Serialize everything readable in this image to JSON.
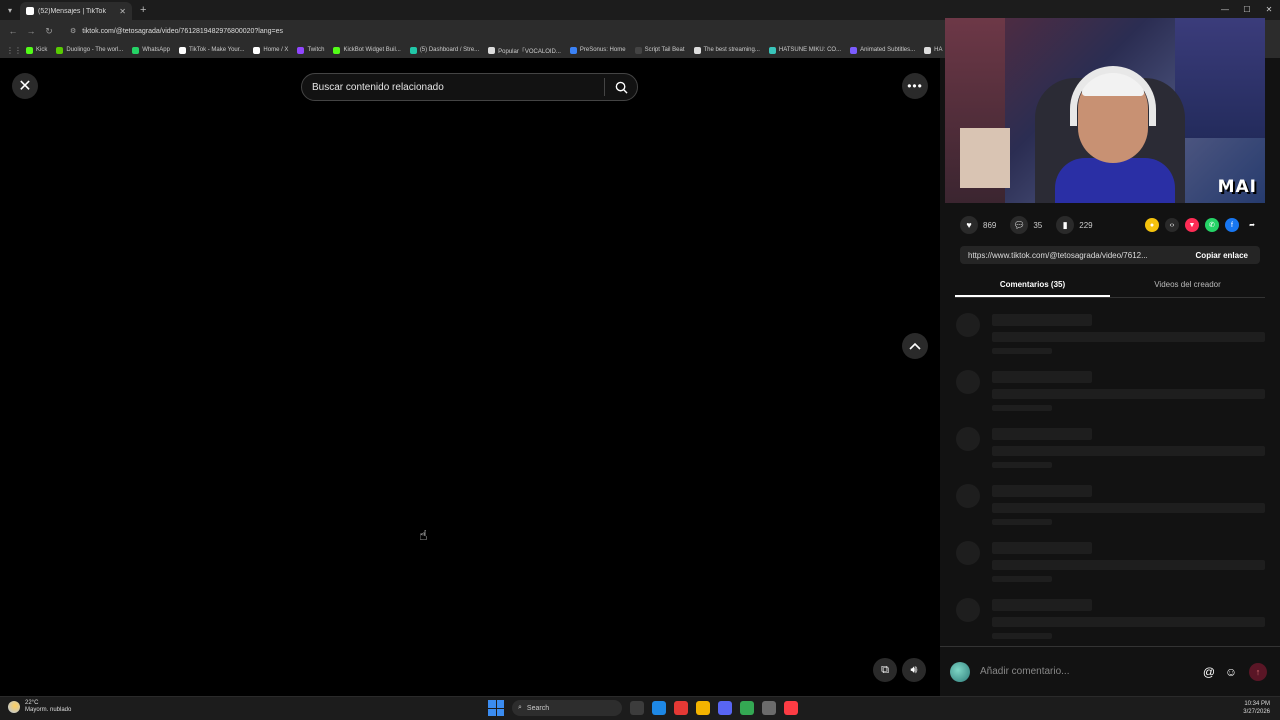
{
  "browser": {
    "tab_title": "(52)Mensajes | TikTok",
    "url": "tiktok.com/@tetosagrada/video/7612819482976800020?lang=es",
    "bookmarks": [
      {
        "label": "Kick",
        "color": "#53fc18"
      },
      {
        "label": "Duolingo - The worl...",
        "color": "#58cc02"
      },
      {
        "label": "WhatsApp",
        "color": "#25d366"
      },
      {
        "label": "TikTok - Make Your...",
        "color": "#ffffff"
      },
      {
        "label": "Home / X",
        "color": "#ffffff"
      },
      {
        "label": "Twitch",
        "color": "#9146ff"
      },
      {
        "label": "KickBot Widget Buil...",
        "color": "#53fc18"
      },
      {
        "label": "(5) Dashboard / Stre...",
        "color": "#21c7a8"
      },
      {
        "label": "Popular「VOCALOID...",
        "color": "#dddddd"
      },
      {
        "label": "PreSonus: Home",
        "color": "#3b82f6"
      },
      {
        "label": "Script Tail Beat",
        "color": "#444444"
      },
      {
        "label": "The best streaming...",
        "color": "#dddddd"
      },
      {
        "label": "HATSUNE MIKU: CO...",
        "color": "#39c5bb"
      },
      {
        "label": "Animated Subtitles...",
        "color": "#7b5cff"
      },
      {
        "label": "HA",
        "color": "#dddddd"
      }
    ]
  },
  "page": {
    "search_placeholder": "Buscar contenido relacionado",
    "close_icon": "close-icon",
    "more_icon": "more-icon"
  },
  "webcam": {
    "label": "MAI"
  },
  "stats": {
    "likes": "869",
    "comments": "35",
    "saves": "229"
  },
  "share": {
    "link": "https://www.tiktok.com/@tetosagrada/video/7612...",
    "copy_label": "Copiar enlace",
    "icons": [
      {
        "name": "coin-icon",
        "color": "#f4c20d",
        "glyph": "●"
      },
      {
        "name": "embed-icon",
        "color": "#2a2a2a",
        "glyph": "‹›"
      },
      {
        "name": "send-icon",
        "color": "#fe2c55",
        "glyph": "▼"
      },
      {
        "name": "whatsapp-icon",
        "color": "#25d366",
        "glyph": "✆"
      },
      {
        "name": "facebook-icon",
        "color": "#1877f2",
        "glyph": "f"
      },
      {
        "name": "share-arrow-icon",
        "color": "transparent",
        "glyph": "➦"
      }
    ]
  },
  "tabs": {
    "comments": "Comentarios (35)",
    "creator_videos": "Videos del creador"
  },
  "comment_input": {
    "placeholder": "Añadir comentario..."
  },
  "taskbar": {
    "temp": "22°C",
    "weather": "Mayorm. nublado",
    "search": "Search",
    "time": "10:34 PM",
    "date": "3/27/2026"
  }
}
